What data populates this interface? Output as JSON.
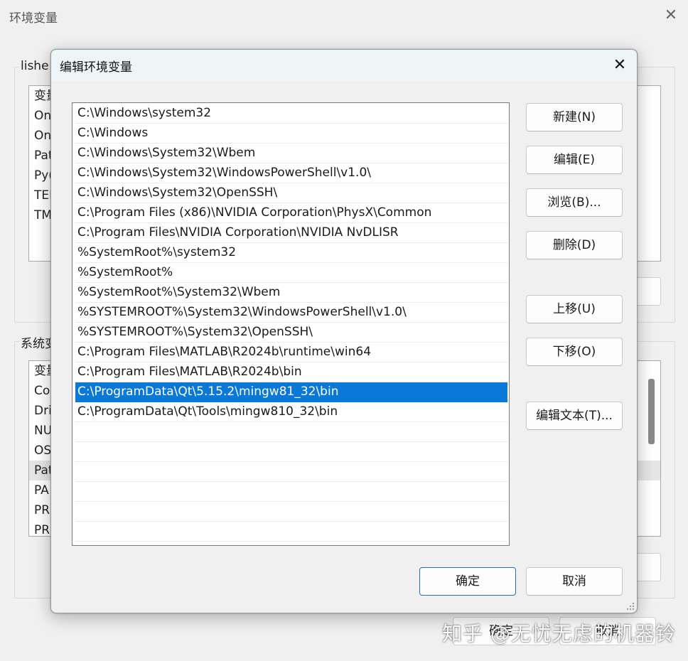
{
  "background_window": {
    "title": "环境变量",
    "user_group_label": "lishe",
    "user_vars_list": [
      "变量",
      "On",
      "On",
      "Pat",
      "Py(",
      "TEI",
      "TM"
    ],
    "system_group_label": "系统变",
    "system_vars_list": [
      "变量",
      "Co",
      "Dri",
      "NU",
      "OS",
      "Pat",
      "PA",
      "PR",
      "PR"
    ],
    "footer_ok": "确定",
    "footer_cancel": "取消"
  },
  "dialog": {
    "title": "编辑环境变量",
    "paths": [
      "C:\\Windows\\system32",
      "C:\\Windows",
      "C:\\Windows\\System32\\Wbem",
      "C:\\Windows\\System32\\WindowsPowerShell\\v1.0\\",
      "C:\\Windows\\System32\\OpenSSH\\",
      "C:\\Program Files (x86)\\NVIDIA Corporation\\PhysX\\Common",
      "C:\\Program Files\\NVIDIA Corporation\\NVIDIA NvDLISR",
      "%SystemRoot%\\system32",
      "%SystemRoot%",
      "%SystemRoot%\\System32\\Wbem",
      "%SYSTEMROOT%\\System32\\WindowsPowerShell\\v1.0\\",
      "%SYSTEMROOT%\\System32\\OpenSSH\\",
      "C:\\Program Files\\MATLAB\\R2024b\\runtime\\win64",
      "C:\\Program Files\\MATLAB\\R2024b\\bin",
      "C:\\ProgramData\\Qt\\5.15.2\\mingw81_32\\bin",
      "C:\\ProgramData\\Qt\\Tools\\mingw810_32\\bin"
    ],
    "selected_index": 14,
    "buttons": {
      "new": "新建(N)",
      "edit": "编辑(E)",
      "browse": "浏览(B)...",
      "delete": "删除(D)",
      "move_up": "上移(U)",
      "move_down": "下移(O)",
      "edit_text": "编辑文本(T)...",
      "ok": "确定",
      "cancel": "取消"
    }
  },
  "watermark": "知乎 @无忧无虑的机器铃",
  "colors": {
    "selection": "#0a78d7",
    "primary_border": "#2b6cb5"
  }
}
